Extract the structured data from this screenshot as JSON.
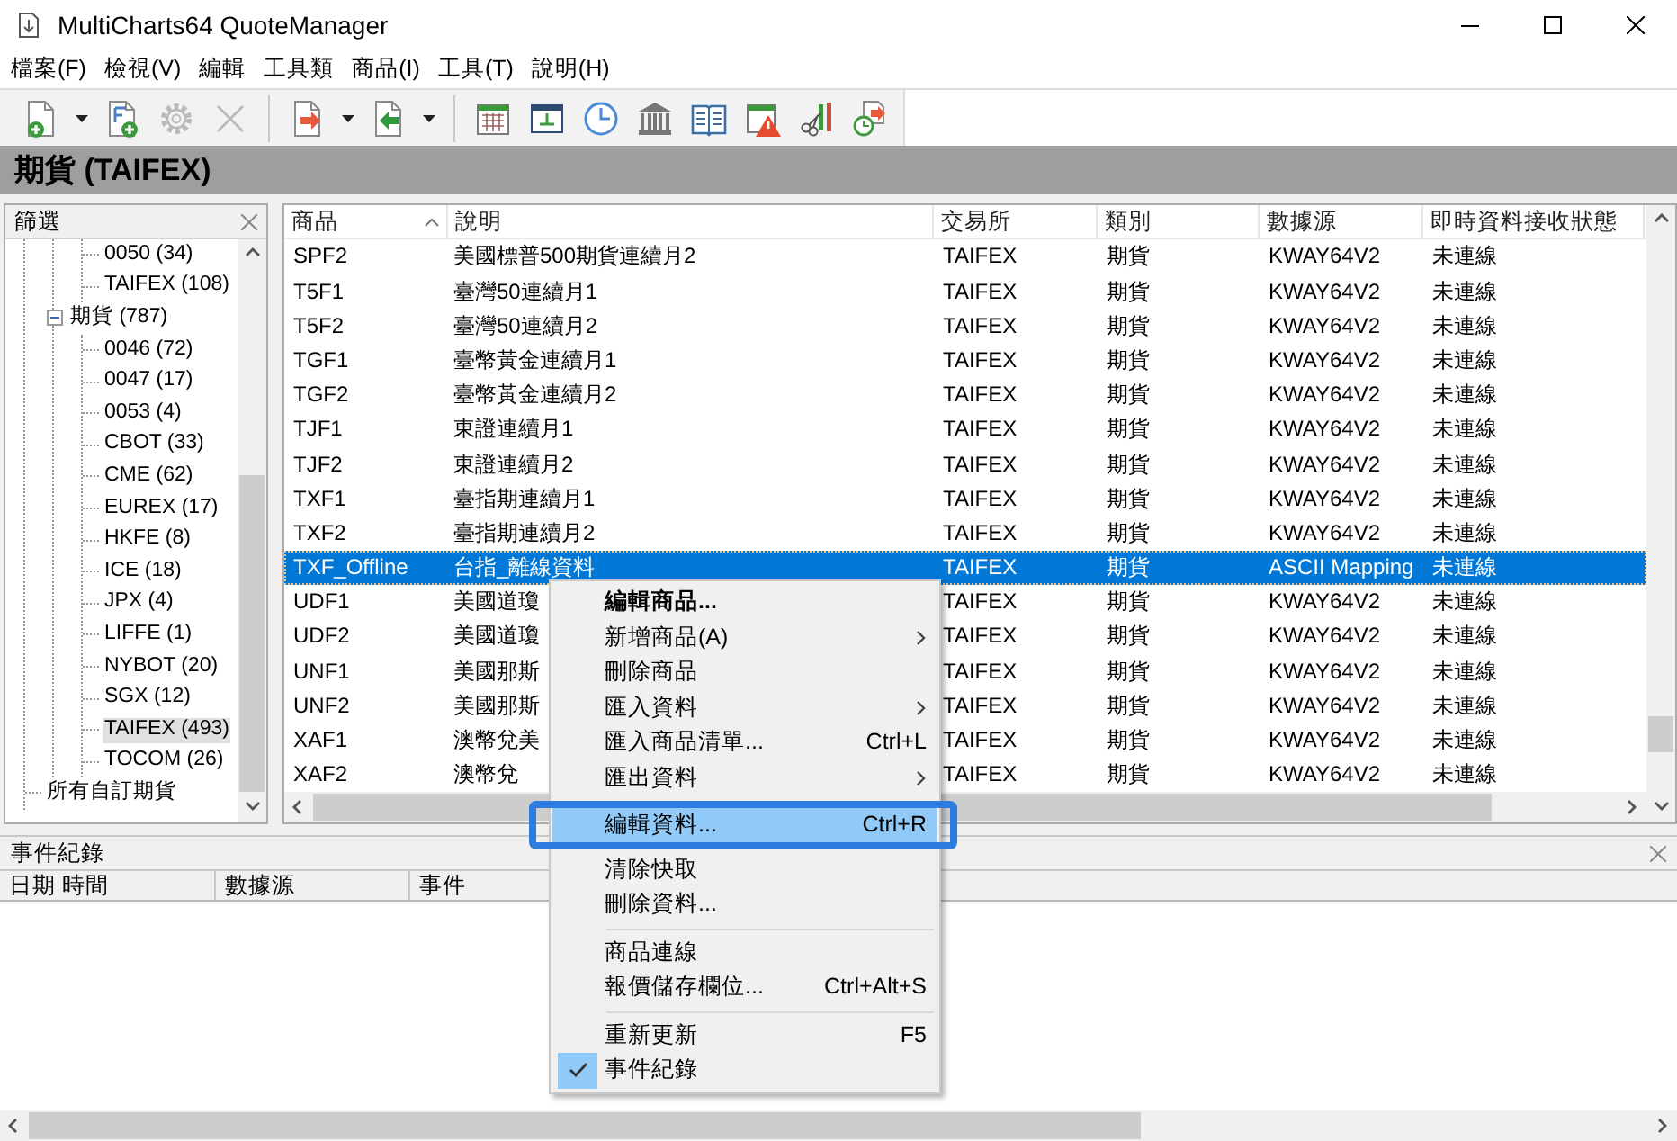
{
  "window": {
    "title": "MultiCharts64 QuoteManager"
  },
  "menu_bar": [
    "檔案(F)",
    "檢視(V)",
    "編輯",
    "工具類",
    "商品(I)",
    "工具(T)",
    "說明(H)"
  ],
  "toolbar": [
    {
      "kind": "button",
      "disabled": false,
      "dropdown": true
    },
    {
      "kind": "button",
      "disabled": false,
      "dropdown": false
    },
    {
      "kind": "button",
      "disabled": true,
      "dropdown": false
    },
    {
      "kind": "button",
      "disabled": true,
      "dropdown": false
    },
    {
      "kind": "separator"
    },
    {
      "kind": "button",
      "disabled": false,
      "dropdown": true
    },
    {
      "kind": "button",
      "disabled": false,
      "dropdown": true
    },
    {
      "kind": "separator"
    },
    {
      "kind": "button",
      "disabled": false,
      "dropdown": false
    },
    {
      "kind": "button",
      "disabled": false,
      "dropdown": false
    },
    {
      "kind": "button",
      "disabled": false,
      "dropdown": false
    },
    {
      "kind": "button",
      "disabled": false,
      "dropdown": false
    },
    {
      "kind": "button",
      "disabled": false,
      "dropdown": false
    },
    {
      "kind": "button",
      "disabled": false,
      "dropdown": false
    },
    {
      "kind": "button",
      "disabled": false,
      "dropdown": false
    },
    {
      "kind": "button",
      "disabled": false,
      "dropdown": false
    }
  ],
  "section_title": "期貨 (TAIFEX)",
  "filter_panel": {
    "title": "篩選",
    "tree": [
      {
        "children": [
          {
            "children": [
              {
                "label": "0050 (34)",
                "selected": false
              },
              {
                "label": "TAIFEX (108)",
                "selected": false
              }
            ]
          },
          {
            "label": "期貨 (787)",
            "selected": false,
            "expanded": true,
            "children": [
              {
                "label": "0046 (72)",
                "selected": false
              },
              {
                "label": "0047 (17)",
                "selected": false
              },
              {
                "label": "0053 (4)",
                "selected": false
              },
              {
                "label": "CBOT (33)",
                "selected": false
              },
              {
                "label": "CME (62)",
                "selected": false
              },
              {
                "label": "EUREX (17)",
                "selected": false
              },
              {
                "label": "HKFE (8)",
                "selected": false
              },
              {
                "label": "ICE (18)",
                "selected": false
              },
              {
                "label": "JPX (4)",
                "selected": false
              },
              {
                "label": "LIFFE (1)",
                "selected": false
              },
              {
                "label": "NYBOT (20)",
                "selected": false
              },
              {
                "label": "SGX (12)",
                "selected": false
              },
              {
                "label": "TAIFEX (493)",
                "selected": true
              },
              {
                "label": "TOCOM (26)",
                "selected": false
              }
            ]
          }
        ]
      },
      {
        "label": "所有自訂期貨",
        "selected": false
      }
    ]
  },
  "table": {
    "columns": [
      {
        "label": "商品",
        "sorted": true
      },
      {
        "label": "說明",
        "sorted": false
      },
      {
        "label": "交易所",
        "sorted": false
      },
      {
        "label": "類別",
        "sorted": false
      },
      {
        "label": "數據源",
        "sorted": false
      },
      {
        "label": "即時資料接收狀態",
        "sorted": false
      }
    ],
    "rows": [
      {
        "cells": [
          "SPF2",
          "美國標普500期貨連續月2",
          "TAIFEX",
          "期貨",
          "KWAY64V2",
          "未連線"
        ],
        "selected": false
      },
      {
        "cells": [
          "T5F1",
          "臺灣50連續月1",
          "TAIFEX",
          "期貨",
          "KWAY64V2",
          "未連線"
        ],
        "selected": false
      },
      {
        "cells": [
          "T5F2",
          "臺灣50連續月2",
          "TAIFEX",
          "期貨",
          "KWAY64V2",
          "未連線"
        ],
        "selected": false
      },
      {
        "cells": [
          "TGF1",
          "臺幣黃金連續月1",
          "TAIFEX",
          "期貨",
          "KWAY64V2",
          "未連線"
        ],
        "selected": false
      },
      {
        "cells": [
          "TGF2",
          "臺幣黃金連續月2",
          "TAIFEX",
          "期貨",
          "KWAY64V2",
          "未連線"
        ],
        "selected": false
      },
      {
        "cells": [
          "TJF1",
          "東證連續月1",
          "TAIFEX",
          "期貨",
          "KWAY64V2",
          "未連線"
        ],
        "selected": false
      },
      {
        "cells": [
          "TJF2",
          "東證連續月2",
          "TAIFEX",
          "期貨",
          "KWAY64V2",
          "未連線"
        ],
        "selected": false
      },
      {
        "cells": [
          "TXF1",
          "臺指期連續月1",
          "TAIFEX",
          "期貨",
          "KWAY64V2",
          "未連線"
        ],
        "selected": false
      },
      {
        "cells": [
          "TXF2",
          "臺指期連續月2",
          "TAIFEX",
          "期貨",
          "KWAY64V2",
          "未連線"
        ],
        "selected": false
      },
      {
        "cells": [
          "TXF_Offline",
          "台指_離線資料",
          "TAIFEX",
          "期貨",
          "ASCII Mapping",
          "未連線"
        ],
        "selected": true
      },
      {
        "cells": [
          "UDF1",
          "美國道瓊",
          "TAIFEX",
          "期貨",
          "KWAY64V2",
          "未連線"
        ],
        "selected": false
      },
      {
        "cells": [
          "UDF2",
          "美國道瓊",
          "TAIFEX",
          "期貨",
          "KWAY64V2",
          "未連線"
        ],
        "selected": false
      },
      {
        "cells": [
          "UNF1",
          "美國那斯",
          "TAIFEX",
          "期貨",
          "KWAY64V2",
          "未連線"
        ],
        "selected": false
      },
      {
        "cells": [
          "UNF2",
          "美國那斯",
          "TAIFEX",
          "期貨",
          "KWAY64V2",
          "未連線"
        ],
        "selected": false
      },
      {
        "cells": [
          "XAF1",
          "澳幣兌美",
          "TAIFEX",
          "期貨",
          "KWAY64V2",
          "未連線"
        ],
        "selected": false
      },
      {
        "cells": [
          "XAF2",
          "澳幣兌",
          "TAIFEX",
          "期貨",
          "KWAY64V2",
          "未連線"
        ],
        "selected": false
      }
    ]
  },
  "context_menu": {
    "items": [
      {
        "kind": "item",
        "label": "編輯商品...",
        "default": true,
        "submenu": false,
        "selected": false,
        "checked": false,
        "framed": false
      },
      {
        "kind": "item",
        "label": "新增商品(A)",
        "default": false,
        "submenu": true,
        "selected": false,
        "checked": false,
        "framed": false
      },
      {
        "kind": "item",
        "label": "刪除商品",
        "default": false,
        "submenu": false,
        "selected": false,
        "checked": false,
        "framed": false
      },
      {
        "kind": "item",
        "label": "匯入資料",
        "default": false,
        "submenu": true,
        "selected": false,
        "checked": false,
        "framed": false
      },
      {
        "kind": "item",
        "label": "匯入商品清單...",
        "shortcut": "Ctrl+L",
        "default": false,
        "submenu": false,
        "selected": false,
        "checked": false,
        "framed": false
      },
      {
        "kind": "item",
        "label": "匯出資料",
        "default": false,
        "submenu": true,
        "selected": false,
        "checked": false,
        "framed": false
      },
      {
        "kind": "separator"
      },
      {
        "kind": "item",
        "label": "編輯資料...",
        "shortcut": "Ctrl+R",
        "default": false,
        "submenu": false,
        "selected": true,
        "checked": false,
        "framed": true
      },
      {
        "kind": "item",
        "label": "清除快取",
        "default": false,
        "submenu": false,
        "selected": false,
        "checked": false,
        "framed": false
      },
      {
        "kind": "item",
        "label": "刪除資料...",
        "default": false,
        "submenu": false,
        "selected": false,
        "checked": false,
        "framed": false
      },
      {
        "kind": "separator"
      },
      {
        "kind": "item",
        "label": "商品連線",
        "default": false,
        "submenu": false,
        "selected": false,
        "checked": false,
        "framed": false
      },
      {
        "kind": "item",
        "label": "報價儲存欄位...",
        "shortcut": "Ctrl+Alt+S",
        "default": false,
        "submenu": false,
        "selected": false,
        "checked": false,
        "framed": false
      },
      {
        "kind": "separator"
      },
      {
        "kind": "item",
        "label": "重新更新",
        "shortcut": "F5",
        "default": false,
        "submenu": false,
        "selected": false,
        "checked": false,
        "framed": false
      },
      {
        "kind": "item",
        "label": "事件紀錄",
        "default": false,
        "submenu": false,
        "selected": false,
        "checked": true,
        "framed": false
      }
    ]
  },
  "event_log": {
    "title": "事件紀錄",
    "columns": [
      "日期 時間",
      "數據源",
      "事件"
    ]
  }
}
